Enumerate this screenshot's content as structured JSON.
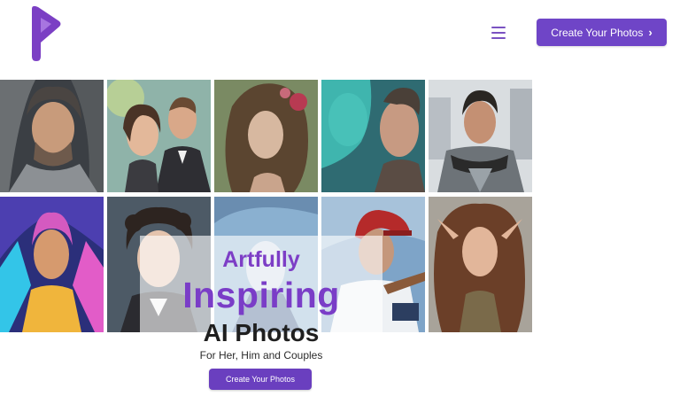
{
  "header": {
    "logo_icon": "p-logo-icon",
    "menu_icon": "hamburger-menu-icon",
    "cta_label": "Create Your Photos",
    "cta_chevron": "›"
  },
  "hero": {
    "line1": "Artfully",
    "line2": "Inspiring",
    "line3": "AI Photos",
    "subtitle": "For Her, Him and Couples",
    "button_label": "Create Your Photos"
  },
  "gallery": {
    "tiles": [
      {
        "name": "portrait-warrior-knight"
      },
      {
        "name": "portrait-couple-formal"
      },
      {
        "name": "portrait-woman-flower-hair"
      },
      {
        "name": "portrait-alien-and-man"
      },
      {
        "name": "portrait-armored-hero"
      },
      {
        "name": "portrait-neon-superheroine"
      },
      {
        "name": "portrait-curly-hair-man"
      },
      {
        "name": "portrait-blue-fantasy"
      },
      {
        "name": "portrait-baseball-player"
      },
      {
        "name": "portrait-elf-woman"
      }
    ]
  },
  "colors": {
    "brand": "#6f45c7",
    "heading": "#7a3dc7"
  }
}
